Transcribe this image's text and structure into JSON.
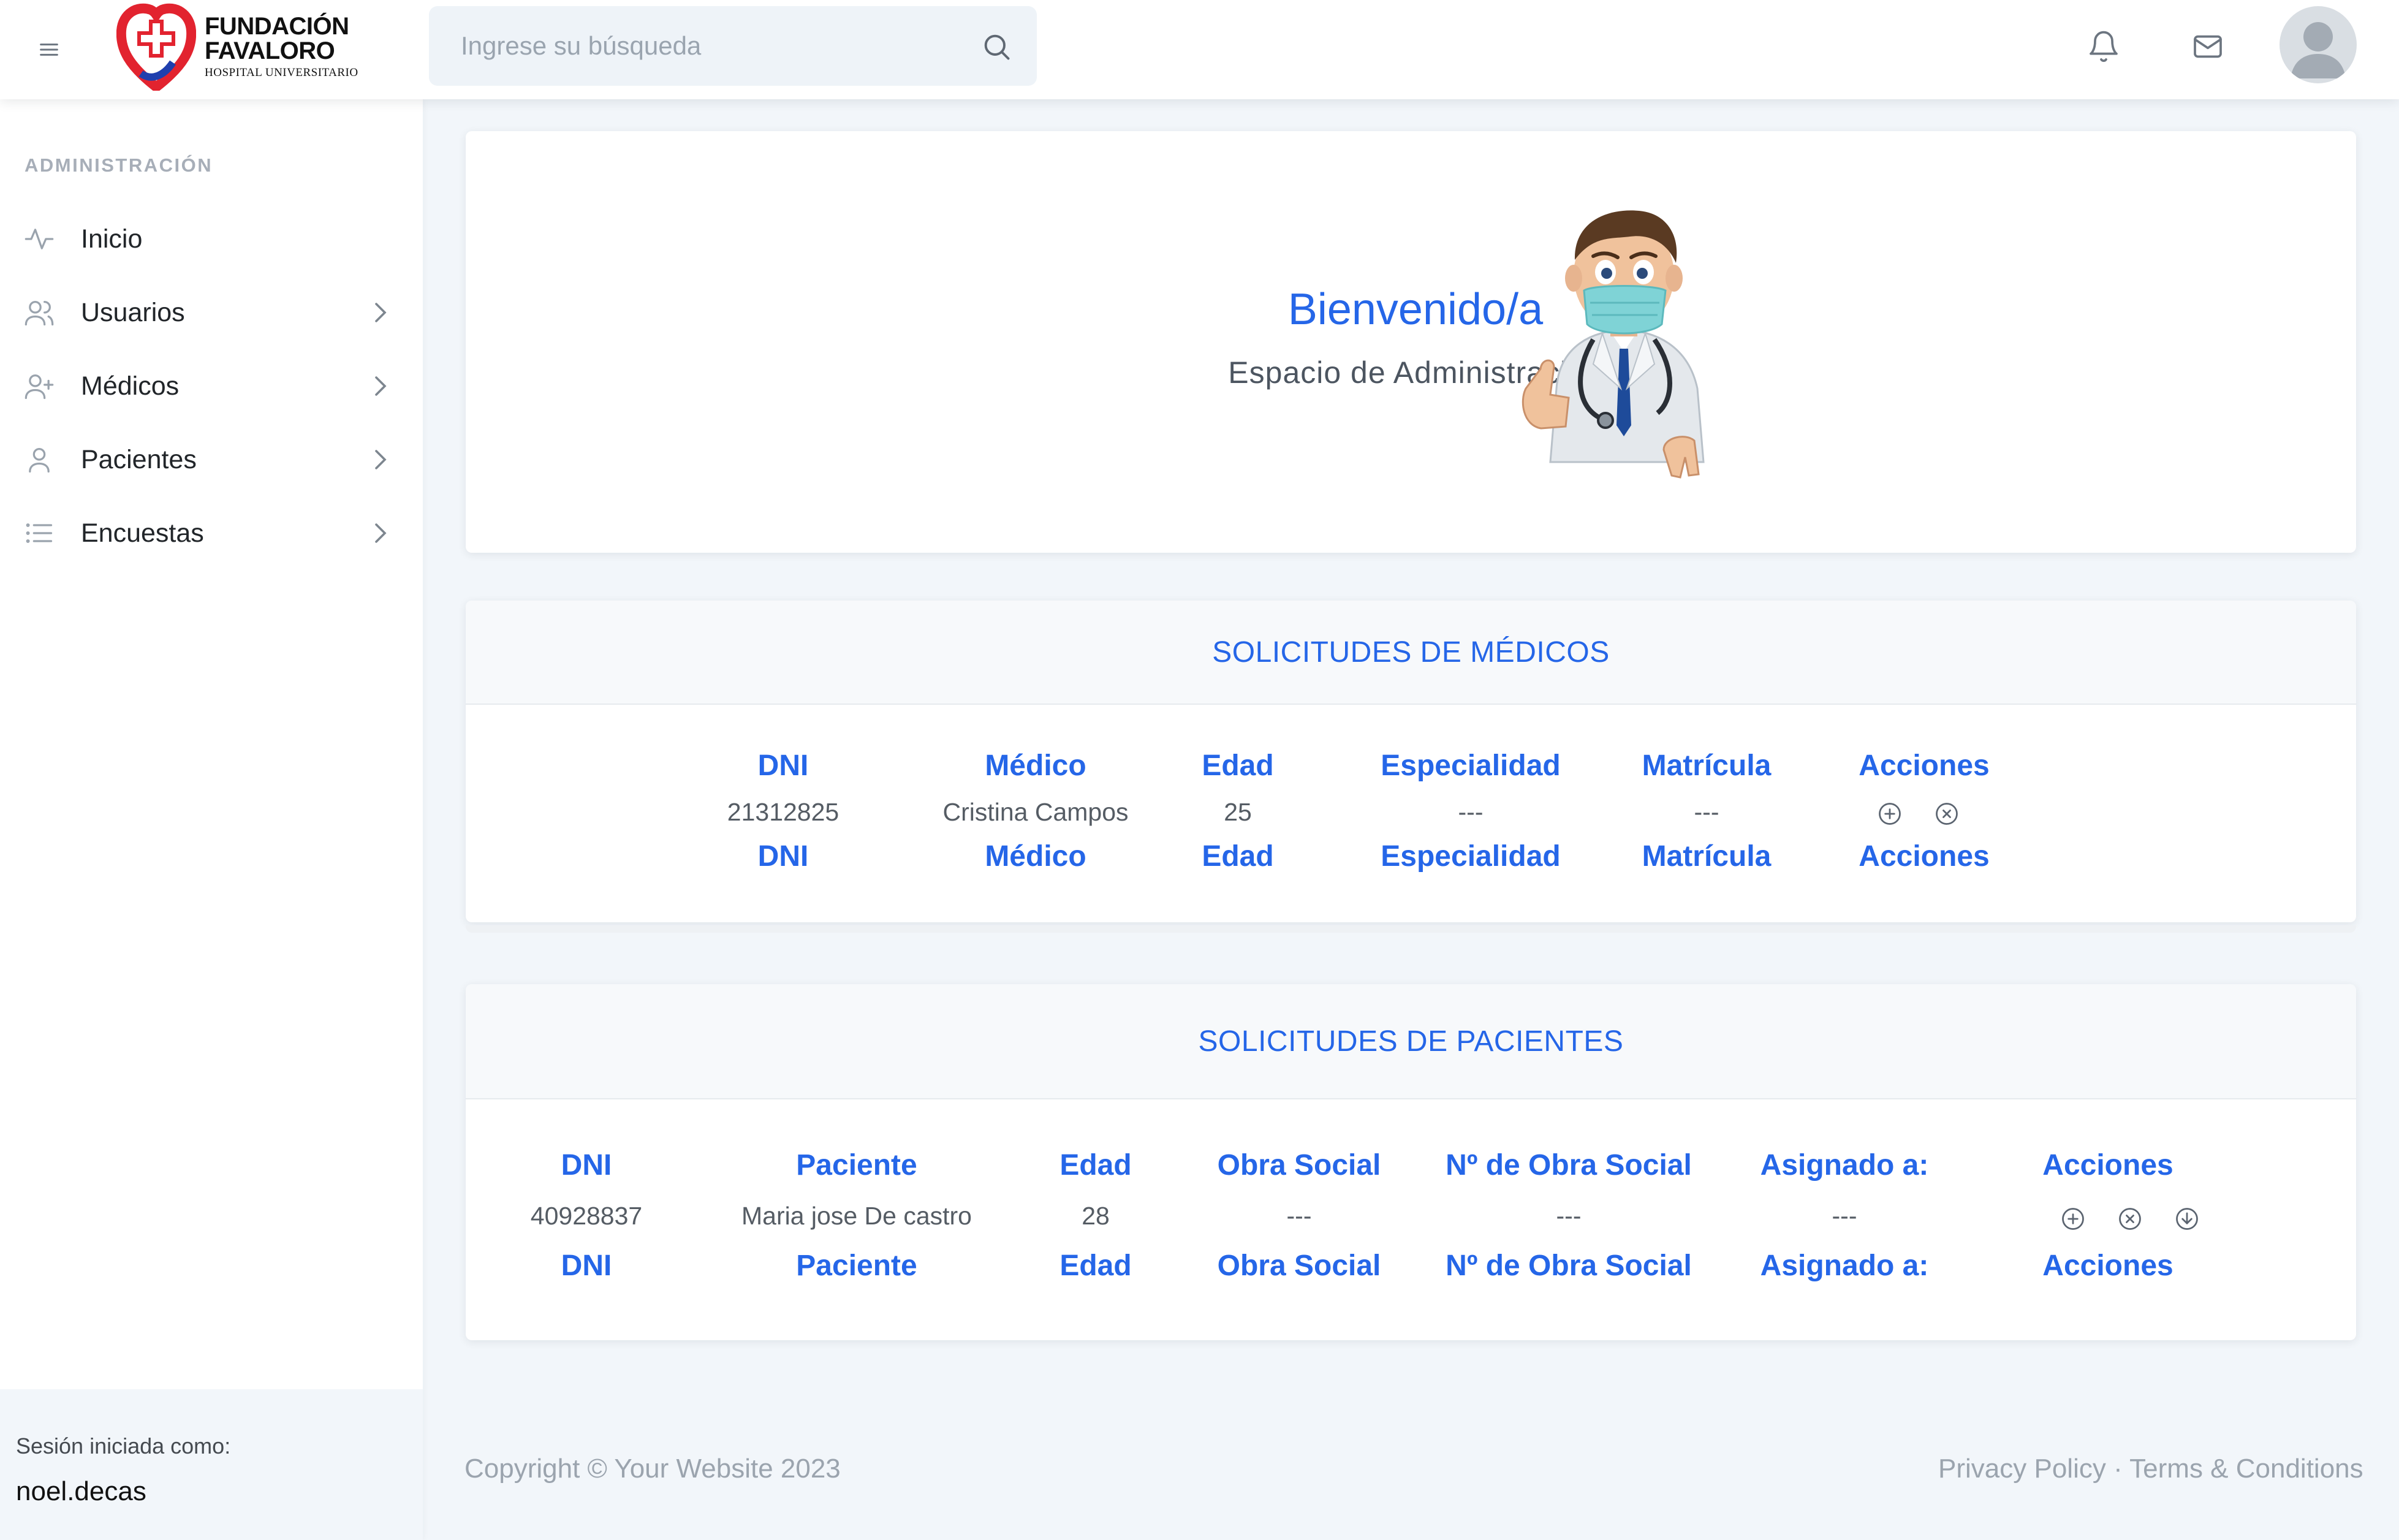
{
  "brand": {
    "line1": "FUNDACIÓN",
    "line2": "FAVALORO",
    "line3": "HOSPITAL UNIVERSITARIO",
    "colors": {
      "red": "#e2232f",
      "blue": "#1f3fae"
    }
  },
  "search": {
    "placeholder": "Ingrese su búsqueda"
  },
  "icons": {
    "menu": "menu-icon",
    "search": "search-icon",
    "bell": "bell-icon",
    "mail": "mail-icon",
    "avatar": "user-avatar-icon"
  },
  "sidebar": {
    "heading": "ADMINISTRACIÓN",
    "items": [
      {
        "label": "Inicio",
        "icon": "activity-icon",
        "has_submenu": false
      },
      {
        "label": "Usuarios",
        "icon": "users-icon",
        "has_submenu": true
      },
      {
        "label": "Médicos",
        "icon": "user-plus-icon",
        "has_submenu": true
      },
      {
        "label": "Pacientes",
        "icon": "user-icon",
        "has_submenu": true
      },
      {
        "label": "Encuestas",
        "icon": "list-icon",
        "has_submenu": true
      }
    ],
    "footer": {
      "label": "Sesión iniciada como:",
      "user": "noel.decas"
    }
  },
  "welcome": {
    "title": "Bienvenido/a",
    "subtitle": "Espacio de Administración"
  },
  "medicos": {
    "title": "SOLICITUDES DE MÉDICOS",
    "headers": [
      "DNI",
      "Médico",
      "Edad",
      "Especialidad",
      "Matrícula",
      "Acciones"
    ],
    "rows": [
      {
        "dni": "21312825",
        "nombre": "Cristina Campos",
        "edad": "25",
        "especialidad": "---",
        "matricula": "---",
        "actions": [
          "add-circle-icon",
          "close-circle-icon"
        ]
      }
    ],
    "footer_headers": [
      "DNI",
      "Médico",
      "Edad",
      "Especialidad",
      "Matrícula",
      "Acciones"
    ]
  },
  "pacientes": {
    "title": "SOLICITUDES DE PACIENTES",
    "headers": [
      "DNI",
      "Paciente",
      "Edad",
      "Obra Social",
      "Nº de Obra Social",
      "Asignado a:",
      "Acciones"
    ],
    "rows": [
      {
        "dni": "40928837",
        "nombre": "Maria jose De castro",
        "edad": "28",
        "obra_social": "---",
        "nro_obra_social": "---",
        "asignado": "---",
        "actions": [
          "add-circle-icon",
          "close-circle-icon",
          "download-circle-icon"
        ]
      }
    ],
    "footer_headers": [
      "DNI",
      "Paciente",
      "Edad",
      "Obra Social",
      "Nº de Obra Social",
      "Asignado a:",
      "Acciones"
    ]
  },
  "footer": {
    "copyright": "Copyright © Your Website 2023",
    "privacy": "Privacy Policy",
    "separator": "·",
    "terms": "Terms & Conditions"
  },
  "colors": {
    "accent": "#2566e8",
    "background": "#f2f6fa",
    "muted": "#9ba4ae"
  }
}
